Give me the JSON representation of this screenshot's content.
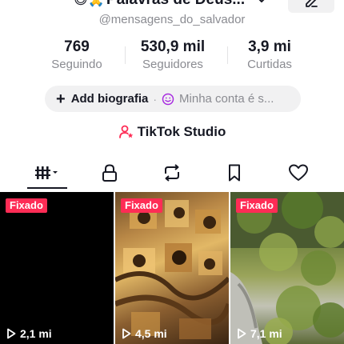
{
  "profile": {
    "display_emoji": "😄🙏",
    "display_name": "Palavras de Deus...",
    "username": "@mensagens_do_salvador"
  },
  "stats": [
    {
      "value": "769",
      "label": "Seguindo"
    },
    {
      "value": "530,9 mil",
      "label": "Seguidores"
    },
    {
      "value": "3,9 mi",
      "label": "Curtidas"
    }
  ],
  "bio": {
    "add_label": "Add biografia",
    "separator": "·",
    "account_label": "Minha conta é s..."
  },
  "studio": {
    "label": "TikTok Studio"
  },
  "tabs": [
    {
      "name": "videos",
      "icon": "grid-icon",
      "selected": true
    },
    {
      "name": "private",
      "icon": "lock-icon",
      "selected": false
    },
    {
      "name": "reposts",
      "icon": "repost-icon",
      "selected": false
    },
    {
      "name": "favorites",
      "icon": "bookmark-icon",
      "selected": false
    },
    {
      "name": "liked",
      "icon": "heart-icon",
      "selected": false
    }
  ],
  "videos": [
    {
      "pinned_label": "Fixado",
      "views": "2,1 mi"
    },
    {
      "pinned_label": "Fixado",
      "views": "4,5 mi"
    },
    {
      "pinned_label": "Fixado",
      "views": "7,1 mi"
    }
  ],
  "colors": {
    "accent": "#fe2c55",
    "text": "#161823",
    "muted": "#8a8b91",
    "pill_bg": "#f1f1f2"
  }
}
